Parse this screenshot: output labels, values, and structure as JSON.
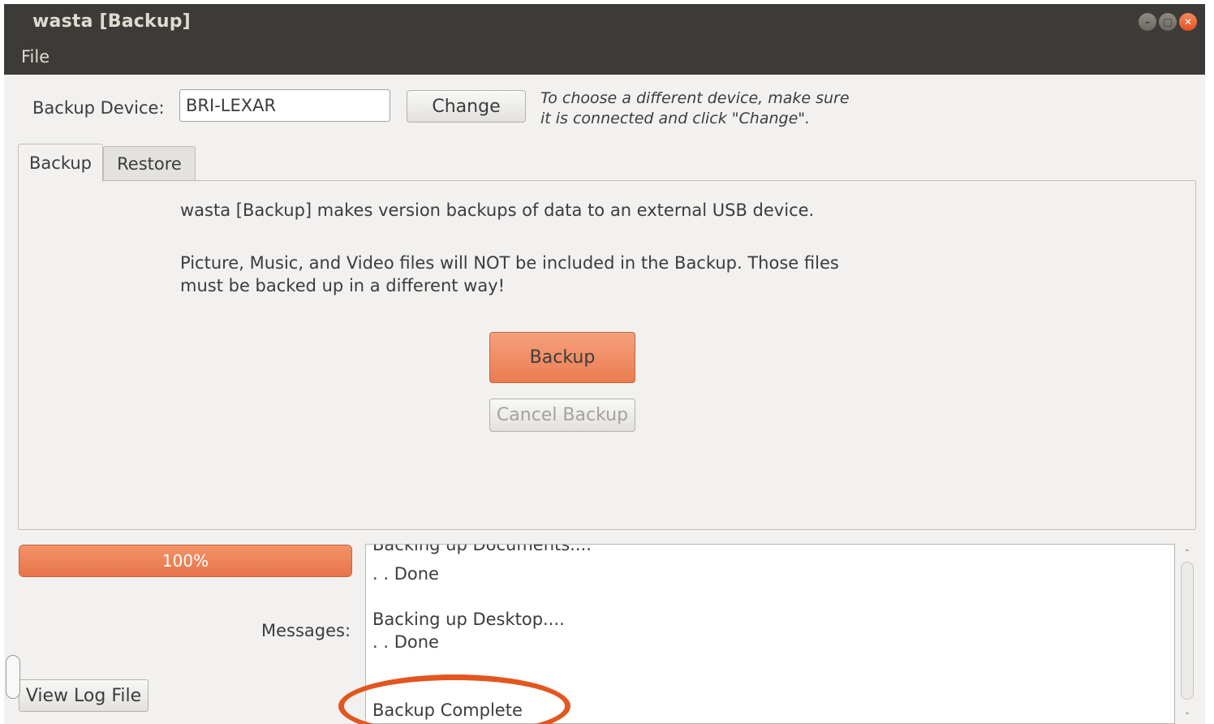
{
  "window": {
    "title": "wasta [Backup]"
  },
  "menu": {
    "file": "File"
  },
  "device": {
    "label": "Backup Device:",
    "value": "BRI-LEXAR",
    "change_label": "Change",
    "hint_line1": "To choose a different device, make sure",
    "hint_line2": "it is connected and click \"Change\"."
  },
  "tabs": [
    {
      "label": "Backup",
      "active": true
    },
    {
      "label": "Restore",
      "active": false
    }
  ],
  "backup_tab": {
    "description1": "wasta [Backup] makes version backups of data to an external USB device.",
    "description2_line1": "Picture, Music, and Video files will NOT be included in the Backup.  Those files",
    "description2_line2": "must be backed up in a different way!",
    "backup_label": "Backup",
    "cancel_label": "Cancel Backup"
  },
  "progress": {
    "value": 100,
    "label": "100%"
  },
  "messages": {
    "label": "Messages:",
    "lines": [
      "Backing up Documents....",
      ". . Done",
      "",
      "Backing up Desktop....",
      ". . Done",
      "",
      "",
      "Backup Complete"
    ]
  },
  "log": {
    "label": "View Log File"
  },
  "colors": {
    "accent": "#ea7d51",
    "annotation": "#e2561f",
    "titlebar": "#3c3b37"
  }
}
